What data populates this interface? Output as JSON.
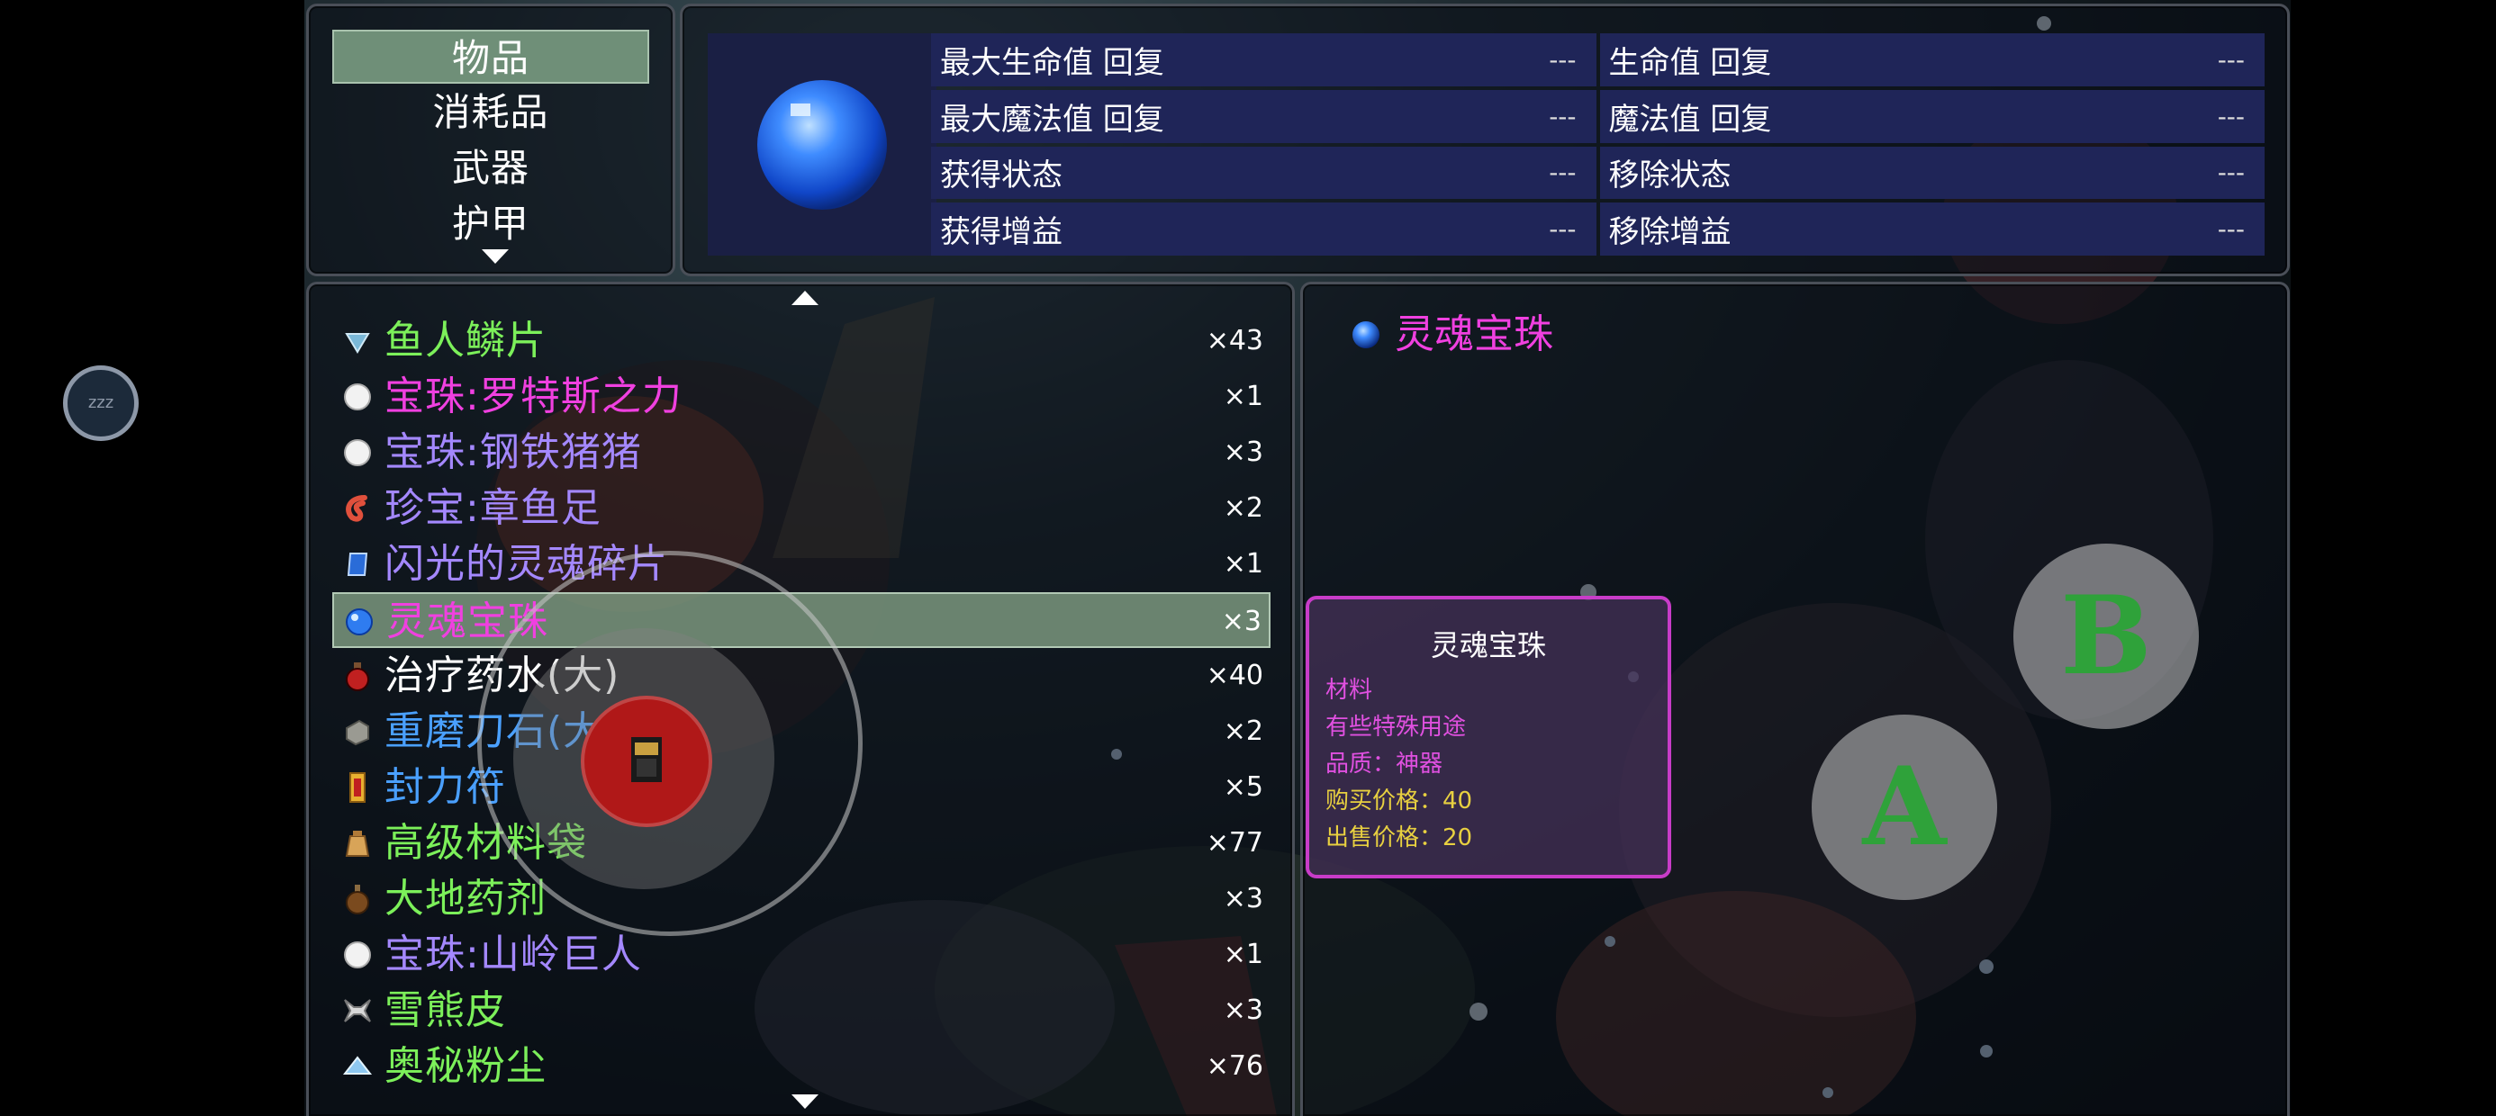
{
  "categories": {
    "items": [
      {
        "label": "物品"
      },
      {
        "label": "消耗品"
      },
      {
        "label": "武器"
      },
      {
        "label": "护甲"
      }
    ],
    "selected_index": 0
  },
  "effects": {
    "rows": [
      {
        "label": "最大生命值 回复",
        "value": "---"
      },
      {
        "label": "生命值 回复",
        "value": "---"
      },
      {
        "label": "最大魔法值 回复",
        "value": "---"
      },
      {
        "label": "魔法值 回复",
        "value": "---"
      },
      {
        "label": "获得状态",
        "value": "---"
      },
      {
        "label": "移除状态",
        "value": "---"
      },
      {
        "label": "获得增益",
        "value": "---"
      },
      {
        "label": "移除增益",
        "value": "---"
      }
    ]
  },
  "items": {
    "selected_index": 5,
    "list": [
      {
        "name": "鱼人鳞片",
        "count": "×43",
        "color": "#7cf05a",
        "icon": "scale-icon"
      },
      {
        "name": "宝珠:罗特斯之力",
        "count": "×1",
        "color": "#f040e0",
        "icon": "orb-icon"
      },
      {
        "name": "宝珠:钢铁猪猪",
        "count": "×3",
        "color": "#a488ff",
        "icon": "orb-icon"
      },
      {
        "name": "珍宝:章鱼足",
        "count": "×2",
        "color": "#a488ff",
        "icon": "tentacle-icon"
      },
      {
        "name": "闪光的灵魂碎片",
        "count": "×1",
        "color": "#a488ff",
        "icon": "crystal-icon"
      },
      {
        "name": "灵魂宝珠",
        "count": "×3",
        "color": "#f040e0",
        "icon": "blue-orb-icon"
      },
      {
        "name": "治疗药水(大)",
        "count": "×40",
        "color": "#ffffff",
        "icon": "potion-icon"
      },
      {
        "name": "重磨刀石(大)",
        "count": "×2",
        "color": "#4aa0ff",
        "icon": "whetstone-icon"
      },
      {
        "name": "封力符",
        "count": "×5",
        "color": "#4aa0ff",
        "icon": "talisman-icon"
      },
      {
        "name": "高级材料袋",
        "count": "×77",
        "color": "#7cf05a",
        "icon": "bag-icon"
      },
      {
        "name": "大地药剂",
        "count": "×3",
        "color": "#7cf05a",
        "icon": "flask-icon"
      },
      {
        "name": "宝珠:山岭巨人",
        "count": "×1",
        "color": "#a488ff",
        "icon": "orb-icon"
      },
      {
        "name": "雪熊皮",
        "count": "×3",
        "color": "#7cf05a",
        "icon": "pelt-icon"
      },
      {
        "name": "奥秘粉尘",
        "count": "×76",
        "color": "#7cf05a",
        "icon": "dust-icon"
      }
    ]
  },
  "detail": {
    "title": "灵魂宝珠",
    "title_color": "#f040e0"
  },
  "tooltip": {
    "title": "灵魂宝珠",
    "lines": [
      {
        "text": "材料",
        "color": "#e050e0"
      },
      {
        "text": "有些特殊用途",
        "color": "#e050e0"
      },
      {
        "text": "品质：神器",
        "color": "#e050e0"
      },
      {
        "text": "购买价格：40",
        "color": "#e8d040"
      },
      {
        "text": "出售价格：20",
        "color": "#e8d040"
      }
    ]
  },
  "controls": {
    "sleep_label": "zzz",
    "button_a": "A",
    "button_b": "B"
  }
}
